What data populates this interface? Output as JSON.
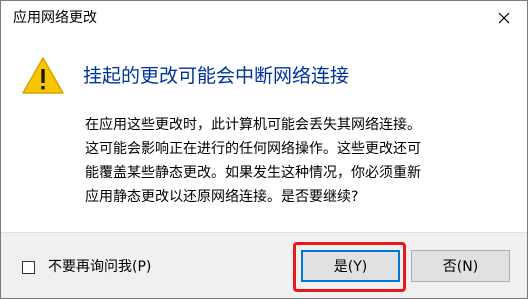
{
  "window": {
    "title": "应用网络更改",
    "close_icon": "close-icon"
  },
  "dialog": {
    "icon": "warning-icon",
    "main_instruction": "挂起的更改可能会中断网络连接",
    "body_lines": [
      "在应用这些更改时，此计算机可能会丢失其网络连接。",
      "这可能会影响正在进行的任何网络操作。这些更改还可",
      "能覆盖某些静态更改。如果发生这种情况，你必须重新",
      "应用静态更改以还原网络连接。是否要继续?"
    ]
  },
  "footer": {
    "checkbox_label": "不要再询问我(P)",
    "checkbox_checked": false,
    "yes_label": "是(Y)",
    "no_label": "否(N)"
  },
  "colors": {
    "main_instruction": "#003399",
    "highlight_border": "#e81818",
    "warning_fill": "#f9c400",
    "default_button_border": "#0078d7"
  }
}
